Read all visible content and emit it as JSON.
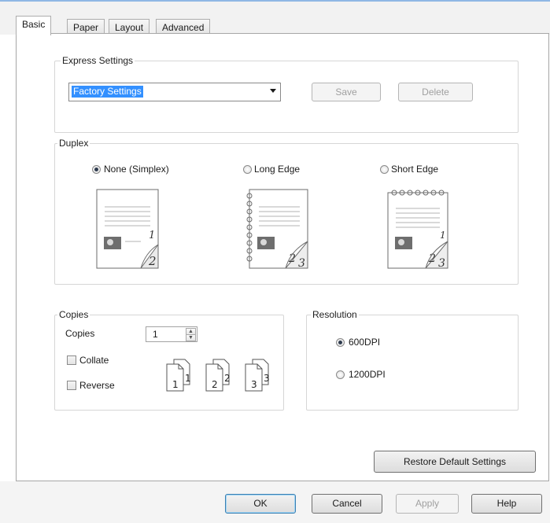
{
  "tabs": [
    "Basic",
    "Paper",
    "Layout",
    "Advanced"
  ],
  "express": {
    "title": "Express Settings",
    "selected": "Factory Settings",
    "save_label": "Save",
    "delete_label": "Delete"
  },
  "duplex": {
    "title": "Duplex",
    "options": [
      "None (Simplex)",
      "Long Edge",
      "Short Edge"
    ],
    "selected_index": 0
  },
  "copies": {
    "title": "Copies",
    "label": "Copies",
    "value": "1",
    "collate_label": "Collate",
    "reverse_label": "Reverse"
  },
  "resolution": {
    "title": "Resolution",
    "options": [
      "600DPI",
      "1200DPI"
    ],
    "selected_index": 0
  },
  "restore_label": "Restore Default Settings",
  "footer": {
    "ok": "OK",
    "cancel": "Cancel",
    "apply": "Apply",
    "help": "Help"
  },
  "colors": {
    "selection": "#3390ff",
    "tab_strip_border": "#8fb7e5"
  }
}
